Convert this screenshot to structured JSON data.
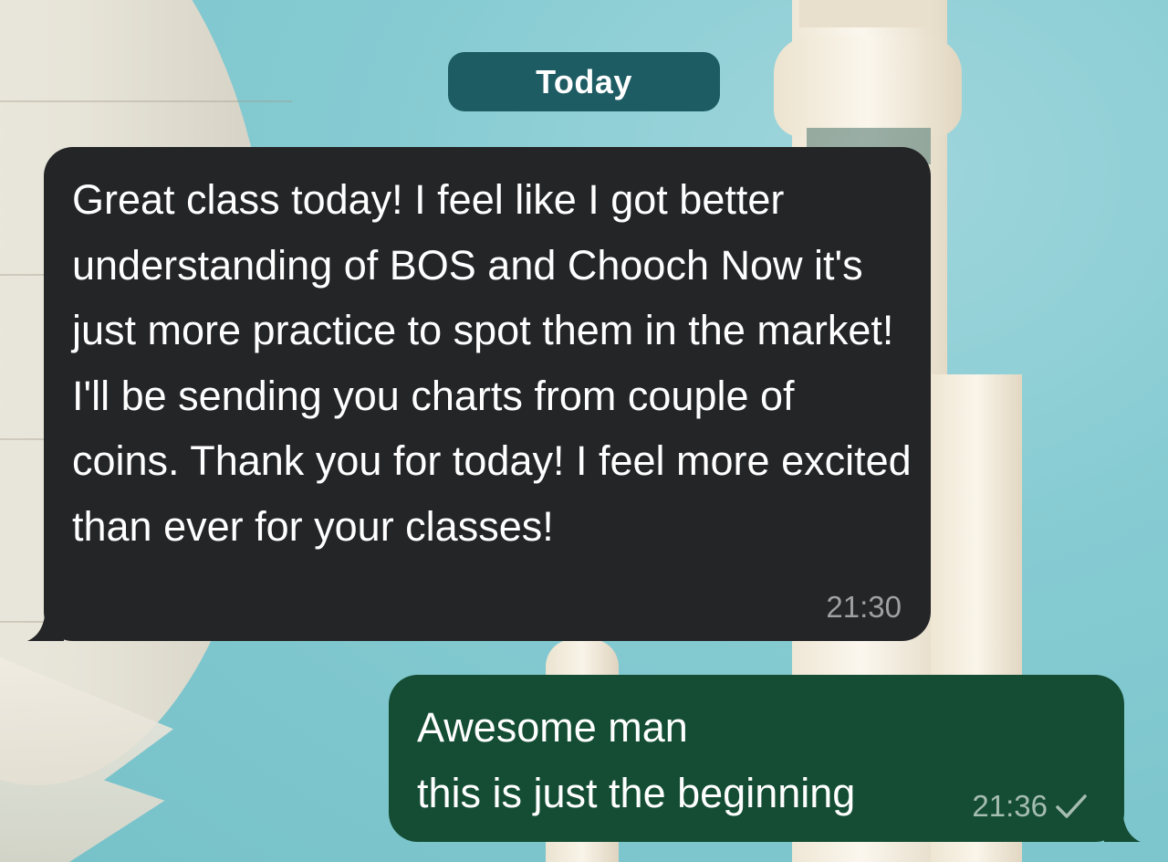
{
  "date_separator": "Today",
  "messages": [
    {
      "direction": "incoming",
      "text": "Great class today! I feel like I got better understanding of BOS and Chooch Now it's just more practice to spot them in the market! I'll be sending you charts from couple of coins. Thank you for today! I feel more excited than ever for your classes!",
      "time": "21:30"
    },
    {
      "direction": "outgoing",
      "lines": [
        "Awesome man",
        "this is just the beginning"
      ],
      "time": "21:36",
      "status_icon": "check-icon"
    }
  ],
  "colors": {
    "date_pill": "#1d5c63",
    "incoming_bubble": "#242527",
    "outgoing_bubble": "#144d34",
    "incoming_time": "#9ea1a4",
    "outgoing_time": "#a6bdb1",
    "wallpaper": "#7ec6cf"
  }
}
